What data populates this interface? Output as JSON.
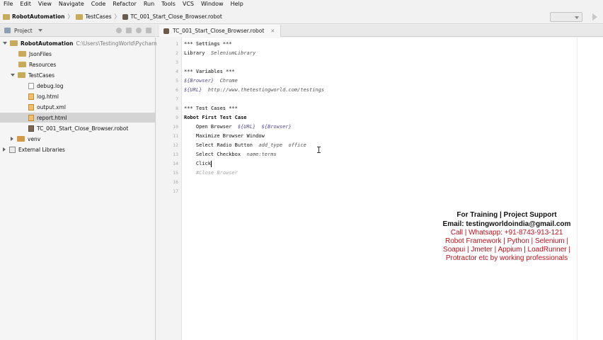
{
  "menu": [
    "File",
    "Edit",
    "View",
    "Navigate",
    "Code",
    "Refactor",
    "Run",
    "Tools",
    "VCS",
    "Window",
    "Help"
  ],
  "nav": {
    "project": "RobotAutomation",
    "folder": "TestCases",
    "file": "TC_001_Start_Close_Browser.robot"
  },
  "project_panel": {
    "title": "Project",
    "tree": [
      {
        "label": "RobotAutomation",
        "path": "C:\\Users\\TestingWorld\\PycharmPro"
      },
      {
        "label": "JsonFiles"
      },
      {
        "label": "Resources"
      },
      {
        "label": "TestCases"
      },
      {
        "label": "debug.log"
      },
      {
        "label": "log.html"
      },
      {
        "label": "output.xml"
      },
      {
        "label": "report.html"
      },
      {
        "label": "TC_001_Start_Close_Browser.robot"
      },
      {
        "label": "venv"
      },
      {
        "label": "External Libraries"
      }
    ]
  },
  "editor": {
    "tab_label": "TC_001_Start_Close_Browser.robot",
    "line_numbers": [
      "1",
      "2",
      "3",
      "4",
      "5",
      "6",
      "7",
      "8",
      "9",
      "10",
      "11",
      "12",
      "13",
      "14",
      "15",
      "16",
      "17"
    ],
    "lines": {
      "l1": "*** Settings ***",
      "l2a": "Library  ",
      "l2b": "SeleniumLibrary",
      "l4": "*** Variables ***",
      "l5a": "${Browser}  ",
      "l5b": "Chrome",
      "l6a": "${URL}  ",
      "l6b": "http://www.thetestingworld.com/testings",
      "l8": "*** Test Cases ***",
      "l9": "Robot First Test Case",
      "l10a": "    Open Browser  ",
      "l10b": "${URL}  ${Browser}",
      "l11": "    Maximize Browser Window",
      "l12a": "    Select Radio Button  ",
      "l12b": "add_type  office",
      "l13a": "    Select Checkbox  ",
      "l13b": "name:terms",
      "l14": "    Click",
      "l15": "    #Close Browser"
    }
  },
  "promo": {
    "line1": "For Training | Project Support",
    "line2": "Email: testingworldoindia@gmail.com",
    "line3": "Call | Whatsapp: +91-8743-913-121",
    "line4": "Robot Framework | Python | Selenium |",
    "line5": "Soapui | Jmeter | Appium | LoadRunner |",
    "line6": "Protractor etc by working professionals"
  }
}
